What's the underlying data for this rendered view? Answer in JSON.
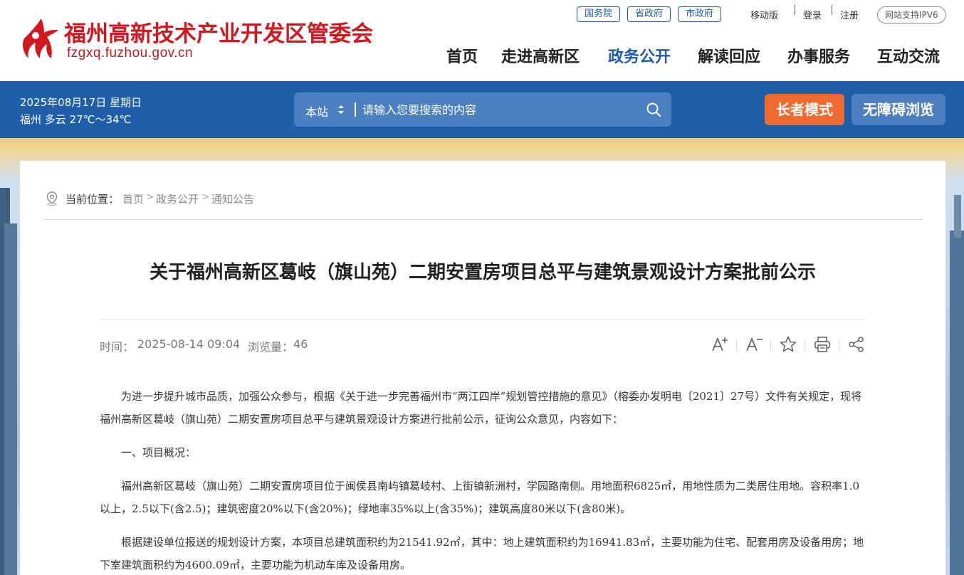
{
  "header": {
    "site_title": "福州高新技术产业开发区管委会",
    "site_domain": "fzgxq.fuzhou.gov.cn",
    "gov_links": [
      "国务院",
      "省政府",
      "市政府"
    ],
    "mobile": "移动版",
    "login": "登录",
    "register": "注册",
    "ipv6": "网站支持IPV6",
    "nav": [
      {
        "label": "首页",
        "active": false
      },
      {
        "label": "走进高新区",
        "active": false
      },
      {
        "label": "政务公开",
        "active": true
      },
      {
        "label": "解读回应",
        "active": false
      },
      {
        "label": "办事服务",
        "active": false
      },
      {
        "label": "互动交流",
        "active": false
      }
    ]
  },
  "infobar": {
    "date": "2025年08月17日 星期日",
    "weather": "福州 多云 27℃～34℃",
    "search_scope": "本站",
    "search_placeholder": "请输入您要搜索的内容",
    "elder_mode": "长者模式",
    "accessible": "无障碍浏览"
  },
  "breadcrumb": {
    "label": "当前位置：",
    "items": [
      "首页",
      "政务公开",
      "通知公告"
    ],
    "separator": ">"
  },
  "article": {
    "title": "关于福州高新区葛岐（旗山苑）二期安置房项目总平与建筑景观设计方案批前公示",
    "time_label": "时间：",
    "time": "2025-08-14 09:04",
    "views_label": "浏览量：",
    "views": "46",
    "paragraphs": [
      "为进一步提升城市品质，加强公众参与，根据《关于进一步完善福州市“两江四岸”规划管控措施的意见》（榕委办发明电〔2021〕27号）文件有关规定，现将福州高新区葛岐（旗山苑）二期安置房项目总平与建筑景观设计方案进行批前公示，征询公众意见，内容如下：",
      "一、项目概况：",
      "福州高新区葛岐（旗山苑）二期安置房项目位于闽侯县南屿镇葛岐村、上街镇新洲村，学园路南侧。用地面积6825㎡，用地性质为二类居住用地。容积率1.0以上，2.5以下(含2.5)；建筑密度20%以下(含20%)；绿地率35%以上(含35%)；建筑高度80米以下(含80米)。",
      "根据建设单位报送的规划设计方案，本项目总建筑面积约为21541.92㎡，其中：地上建筑面积约为16941.83㎡，主要功能为住宅、配套用房及设备用房；地下室建筑面积约为4600.09㎡，主要功能为机动车库及设备用房。"
    ]
  },
  "colors": {
    "brand_red": "#d2171e",
    "nav_blue": "#1e5bb0",
    "bar_blue": "#1f5ea8",
    "elder_orange": "#ef6a2f"
  }
}
